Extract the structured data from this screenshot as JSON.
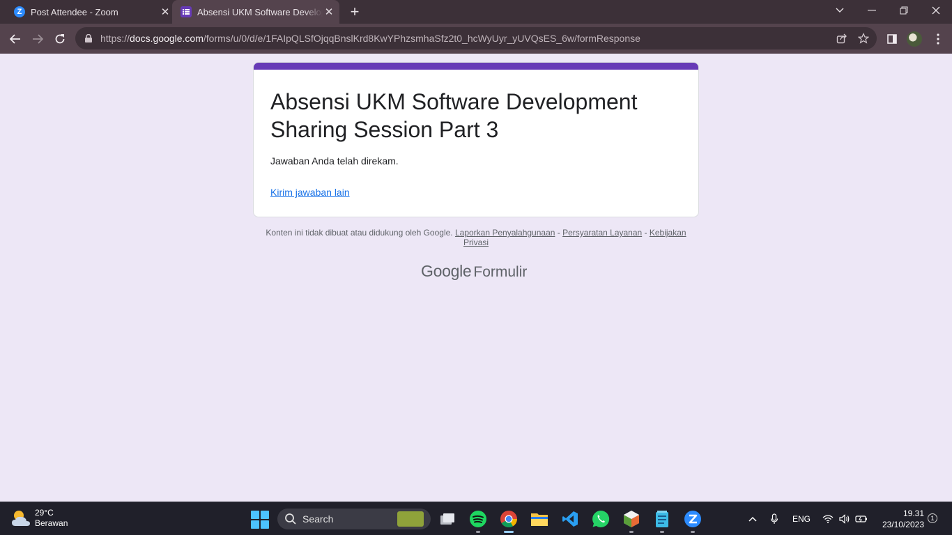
{
  "browser": {
    "tabs": [
      {
        "title": "Post Attendee - Zoom",
        "icon": "zoom-icon",
        "active": false
      },
      {
        "title": "Absensi UKM Software Developm",
        "icon": "google-forms-icon",
        "active": true
      }
    ],
    "url": {
      "prefix": "https://",
      "host": "docs.google.com",
      "path": "/forms/u/0/d/e/1FAIpQLSfOjqqBnslKrd8KwYPhzsmhaSfz2t0_hcWyUyr_yUVQsES_6w/formResponse"
    }
  },
  "form": {
    "title": "Absensi UKM Software Development Sharing Session Part 3",
    "confirmation": "Jawaban Anda telah direkam.",
    "submit_another": "Kirim jawaban lain",
    "accent_color": "#673ab7"
  },
  "footer": {
    "disclaimer": "Konten ini tidak dibuat atau didukung oleh Google.",
    "report_abuse": "Laporkan Penyalahgunaan",
    "sep1": " - ",
    "terms": "Persyaratan Layanan",
    "sep2": " - ",
    "privacy": "Kebijakan Privasi",
    "brand_google": "Google",
    "brand_product": "Formulir"
  },
  "taskbar": {
    "weather": {
      "temp": "29°C",
      "condition": "Berawan"
    },
    "search_label": "Search",
    "language": "ENG",
    "time": "19.31",
    "date": "23/10/2023",
    "notifications": "1",
    "apps": [
      "file-explorer-task-view-icon",
      "spotify-icon",
      "chrome-icon",
      "files-icon",
      "vscode-icon",
      "whatsapp-icon",
      "app-cube-icon",
      "notepad-icon",
      "zoom-icon"
    ]
  }
}
